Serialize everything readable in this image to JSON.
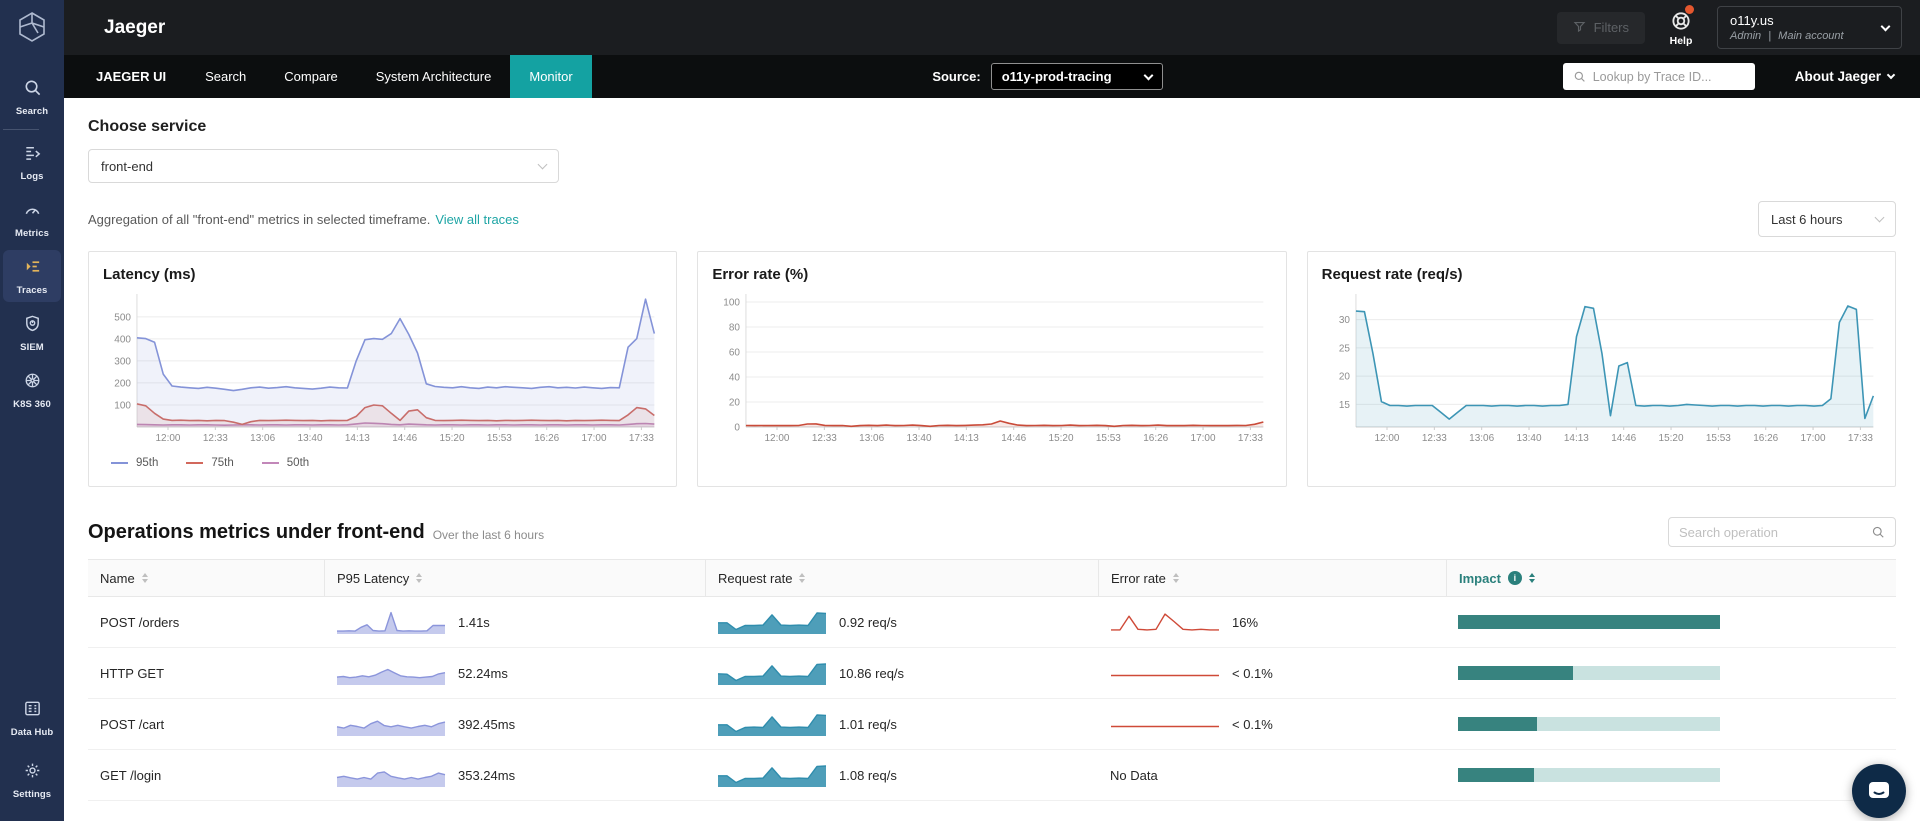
{
  "topbar": {
    "brand": "Jaeger",
    "filters_label": "Filters",
    "help_label": "Help",
    "account_org": "o11y.us",
    "account_role": "Admin",
    "account_sep": "|",
    "account_type": "Main account"
  },
  "sidebar": {
    "items": [
      {
        "id": "search",
        "label": "Search",
        "icon": "search-icon"
      },
      {
        "id": "logs",
        "label": "Logs",
        "icon": "logs-icon"
      },
      {
        "id": "metrics",
        "label": "Metrics",
        "icon": "metrics-icon"
      },
      {
        "id": "traces",
        "label": "Traces",
        "icon": "traces-icon",
        "active": true
      },
      {
        "id": "siem",
        "label": "SIEM",
        "icon": "shield-icon"
      },
      {
        "id": "k8s360",
        "label": "K8S 360",
        "icon": "helm-icon"
      }
    ],
    "bottom_items": [
      {
        "id": "datahub",
        "label": "Data Hub",
        "icon": "data-hub-icon"
      },
      {
        "id": "settings",
        "label": "Settings",
        "icon": "gear-icon"
      }
    ]
  },
  "nav": {
    "brand": "JAEGER UI",
    "tabs": [
      {
        "id": "search",
        "label": "Search"
      },
      {
        "id": "compare",
        "label": "Compare"
      },
      {
        "id": "system-architecture",
        "label": "System Architecture"
      },
      {
        "id": "monitor",
        "label": "Monitor",
        "active": true
      }
    ],
    "source_label": "Source:",
    "source_value": "o11y-prod-tracing",
    "trace_lookup_placeholder": "Lookup by Trace ID...",
    "about": "About Jaeger"
  },
  "monitor": {
    "choose_service_label": "Choose service",
    "service_value": "front-end",
    "aggregation_text": "Aggregation of all \"front-end\" metrics in selected timeframe.",
    "view_all_traces": "View all traces",
    "timeframe_value": "Last 6 hours"
  },
  "chart_data": [
    {
      "id": "latency",
      "type": "area",
      "title": "Latency (ms)",
      "ylim": [
        0,
        590
      ],
      "yticks": [
        100,
        200,
        300,
        400,
        500
      ],
      "grid": true,
      "legend_position": "bottom",
      "xticks": [
        "12:00",
        "12:33",
        "13:06",
        "13:40",
        "14:13",
        "14:46",
        "15:20",
        "15:53",
        "16:26",
        "17:00",
        "17:33"
      ],
      "series": [
        {
          "name": "95th",
          "color": "#8493d8",
          "values": [
            405,
            401,
            385,
            240,
            186,
            181,
            178,
            175,
            180,
            176,
            171,
            165,
            171,
            178,
            181,
            176,
            179,
            183,
            178,
            175,
            172,
            176,
            181,
            178,
            177,
            300,
            396,
            401,
            398,
            424,
            492,
            420,
            336,
            196,
            184,
            180,
            178,
            183,
            178,
            175,
            181,
            178,
            183,
            180,
            178,
            175,
            180,
            183,
            178,
            180,
            177,
            181,
            178,
            175,
            179,
            178,
            362,
            401,
            580,
            424
          ]
        },
        {
          "name": "75th",
          "color": "#d2685c",
          "values": [
            105,
            96,
            62,
            36,
            30,
            31,
            29,
            30,
            28,
            30,
            29,
            22,
            12,
            24,
            30,
            29,
            30,
            31,
            30,
            29,
            30,
            28,
            30,
            29,
            30,
            48,
            88,
            100,
            96,
            62,
            30,
            72,
            78,
            42,
            30,
            29,
            30,
            31,
            30,
            29,
            30,
            28,
            30,
            29,
            30,
            31,
            30,
            29,
            30,
            28,
            30,
            29,
            30,
            31,
            30,
            29,
            55,
            88,
            82,
            52
          ]
        },
        {
          "name": "50th",
          "color": "#c287b9",
          "values": [
            12,
            11,
            10,
            9,
            10,
            10,
            9,
            10,
            10,
            9,
            8,
            9,
            10,
            10,
            9,
            10,
            10,
            9,
            10,
            10,
            9,
            10,
            10,
            9,
            10,
            14,
            18,
            17,
            15,
            12,
            10,
            13,
            12,
            10,
            9,
            10,
            10,
            9,
            10,
            10,
            9,
            10,
            10,
            9,
            10,
            10,
            9,
            10,
            10,
            9,
            10,
            10,
            9,
            10,
            10,
            9,
            12,
            15,
            16,
            13
          ]
        }
      ]
    },
    {
      "id": "error_rate",
      "type": "line",
      "title": "Error rate (%)",
      "ylim": [
        0,
        104
      ],
      "yticks": [
        0,
        20,
        40,
        60,
        80,
        100
      ],
      "grid": true,
      "xticks": [
        "12:00",
        "12:33",
        "13:06",
        "13:40",
        "14:13",
        "14:46",
        "15:20",
        "15:53",
        "16:26",
        "17:00",
        "17:33"
      ],
      "series": [
        {
          "name": "error rate",
          "color": "#c94b39",
          "values": [
            1.2,
            1.1,
            1.2,
            1.1,
            1.2,
            1.1,
            1.2,
            2.4,
            2.5,
            1.3,
            1.1,
            1.2,
            0.6,
            1.1,
            1.4,
            1.1,
            1.5,
            1.1,
            1.2,
            1.5,
            1.1,
            0.6,
            1.2,
            1.4,
            1.1,
            1.3,
            1.5,
            1.8,
            2.4,
            4.8,
            3,
            1.5,
            1.1,
            1.2,
            1.4,
            1.1,
            1.2,
            1.5,
            1.1,
            1.2,
            1.4,
            1.1,
            0.6,
            1.2,
            1.4,
            1.1,
            1.2,
            1.5,
            1.1,
            1.2,
            1.1,
            1.4,
            1.2,
            1.1,
            1.2,
            1.1,
            1.3,
            1.2,
            2.2,
            4
          ]
        }
      ]
    },
    {
      "id": "request_rate",
      "type": "area",
      "title": "Request rate (req/s)",
      "ylim": [
        11,
        34
      ],
      "yticks": [
        15,
        20,
        25,
        30
      ],
      "grid": true,
      "xticks": [
        "12:00",
        "12:33",
        "13:06",
        "13:40",
        "14:13",
        "14:46",
        "15:20",
        "15:53",
        "16:26",
        "17:00",
        "17:33"
      ],
      "series": [
        {
          "name": "request rate",
          "color": "#3d95b5",
          "values": [
            31.5,
            31.4,
            24,
            15.5,
            14.8,
            14.8,
            14.7,
            14.8,
            14.8,
            14.8,
            13.6,
            12.4,
            13.6,
            14.8,
            14.8,
            14.8,
            14.7,
            14.8,
            14.8,
            14.7,
            14.8,
            14.8,
            14.7,
            14.8,
            14.8,
            15,
            27,
            32.3,
            32,
            24,
            13,
            21.8,
            22.4,
            14.8,
            14.7,
            14.8,
            14.8,
            14.7,
            14.8,
            15,
            14.9,
            14.8,
            14.7,
            14.8,
            14.8,
            14.7,
            14.8,
            14.8,
            14.7,
            14.8,
            14.8,
            14.7,
            14.8,
            14.8,
            14.7,
            14.8,
            16,
            29.5,
            32.4,
            31.8,
            12.5,
            16.5
          ]
        }
      ]
    }
  ],
  "operations": {
    "title": "Operations metrics under front-end",
    "subtitle": "Over the last 6 hours",
    "search_placeholder": "Search operation",
    "columns": [
      "Name",
      "P95 Latency",
      "Request rate",
      "Error rate",
      "Impact"
    ],
    "rows": [
      {
        "name": "POST /orders",
        "p95_value": "1.41s",
        "p95_spark": {
          "style": "area",
          "ymax": 7,
          "fill": 0.5,
          "values": [
            0.6,
            0.6,
            0.7,
            0.6,
            1.8,
            2.6,
            0.8,
            0.6,
            0.7,
            6.5,
            0.8,
            0.6,
            0.7,
            0.6,
            0.6,
            0.7,
            2.4,
            2.4,
            2.4
          ]
        },
        "req_value": "0.92 req/s",
        "req_spark": {
          "style": "area",
          "ymax": 5.6,
          "fill": 0.85,
          "values": [
            2.6,
            2.6,
            0.9,
            1.9,
            1.9,
            2,
            4.6,
            2,
            1.9,
            2,
            1.9,
            5.1,
            5
          ]
        },
        "err_value": "16%",
        "err_spark": {
          "style": "line",
          "ymax": 4.2,
          "values": [
            0.6,
            0.6,
            3.2,
            0.7,
            0.6,
            0.7,
            3.6,
            2.2,
            0.7,
            0.6,
            0.7,
            0.6,
            0.6
          ]
        },
        "impact_pct": 100
      },
      {
        "name": "HTTP GET",
        "p95_value": "52.24ms",
        "p95_spark": {
          "style": "area",
          "ymax": 7,
          "fill": 0.5,
          "values": [
            2.2,
            2.4,
            2,
            2.2,
            2.6,
            2.3,
            2.8,
            3.8,
            4.6,
            3.6,
            2.6,
            2.3,
            2.2,
            2,
            2.2,
            2.4,
            3.2,
            3.6
          ]
        },
        "req_value": "10.86 req/s",
        "req_spark": {
          "style": "area",
          "ymax": 5.6,
          "fill": 0.85,
          "values": [
            2.6,
            2.5,
            0.9,
            1.9,
            1.9,
            2,
            4.6,
            2,
            1.9,
            2,
            1.9,
            5,
            5.1
          ]
        },
        "err_value": "< 0.1%",
        "err_spark": {
          "style": "line",
          "ymax": 2.6,
          "values": [
            1,
            1,
            1,
            1,
            1,
            1,
            1,
            1,
            1,
            1
          ]
        },
        "impact_pct": 44
      },
      {
        "name": "POST /cart",
        "p95_value": "392.45ms",
        "p95_spark": {
          "style": "area",
          "ymax": 7,
          "fill": 0.5,
          "values": [
            2.6,
            2.2,
            3.1,
            2.7,
            2.2,
            3.6,
            4.4,
            3,
            2.6,
            3.1,
            2.6,
            2.2,
            2.7,
            3.1,
            2.6,
            3.6,
            4.1
          ]
        },
        "req_value": "1.01 req/s",
        "req_spark": {
          "style": "area",
          "ymax": 5.6,
          "fill": 0.85,
          "values": [
            2.6,
            2.6,
            0.9,
            1.9,
            2,
            1.9,
            4.6,
            2,
            1.9,
            2,
            1.9,
            5.1,
            5
          ]
        },
        "err_value": "< 0.1%",
        "err_spark": {
          "style": "line",
          "ymax": 2.6,
          "values": [
            1,
            1,
            1,
            1,
            1,
            1,
            1,
            1,
            1,
            1
          ]
        },
        "impact_pct": 30
      },
      {
        "name": "GET /login",
        "p95_value": "353.24ms",
        "p95_spark": {
          "style": "area",
          "ymax": 7,
          "fill": 0.5,
          "values": [
            2.7,
            3.1,
            2.6,
            2.2,
            2.7,
            2.2,
            4.1,
            4.5,
            3.1,
            2.6,
            2.2,
            2.7,
            2.2,
            2.7,
            3.1,
            4.1,
            3.6
          ]
        },
        "req_value": "1.08 req/s",
        "req_spark": {
          "style": "area",
          "ymax": 5.6,
          "fill": 0.85,
          "values": [
            2.6,
            2.6,
            0.9,
            1.9,
            1.9,
            2,
            4.6,
            2,
            1.9,
            2,
            1.9,
            5,
            5.1
          ]
        },
        "err_value": "No Data",
        "err_spark": null,
        "impact_pct": 29
      }
    ]
  },
  "colors": {
    "accent_teal": "#14a2a2",
    "link_teal": "#1ea5a5",
    "impact_fill": "#37837f",
    "impact_track": "#c9e2e0",
    "latency_spark": "#8b95db",
    "request_spark": "#2f8dad",
    "error_spark": "#cf4a38",
    "sidebar_active_icon": "#e3b45a",
    "notification_dot": "#e4572e"
  }
}
